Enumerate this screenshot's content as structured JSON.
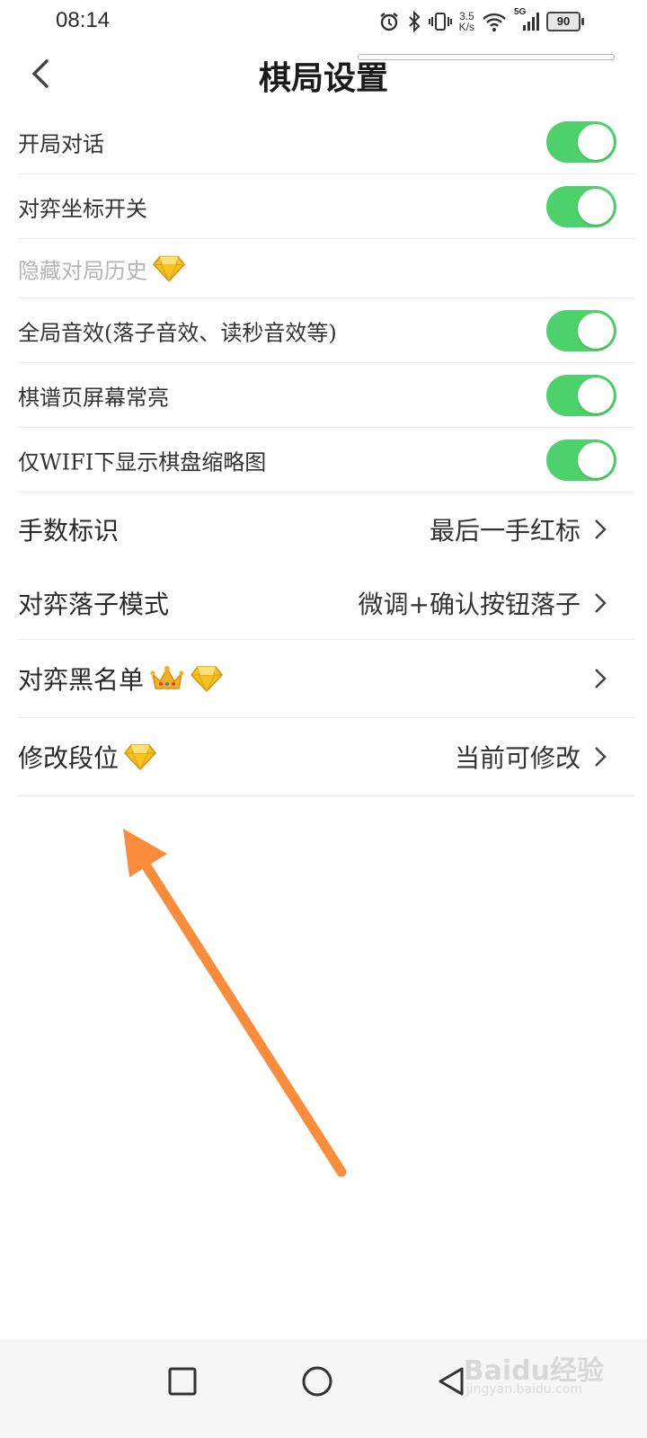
{
  "status_bar": {
    "time": "08:14",
    "net_speed_value": "3.5",
    "net_speed_unit": "K/s",
    "network": "5G",
    "battery": "90",
    "icons": [
      "alarm-icon",
      "bluetooth-icon",
      "vibrate-icon",
      "wifi-icon",
      "signal-icon",
      "battery-icon"
    ]
  },
  "header": {
    "title": "棋局设置",
    "back_icon": "back-arrow-icon"
  },
  "settings": {
    "opening_dialog": {
      "label": "开局对话",
      "enabled": true
    },
    "coordinates": {
      "label": "对弈坐标开关",
      "enabled": true
    },
    "hide_history": {
      "label": "隐藏对局历史",
      "disabled": true,
      "badge": "diamond-icon"
    },
    "global_sound": {
      "label": "全局音效(落子音效、读秒音效等)",
      "enabled": true
    },
    "screen_on": {
      "label": "棋谱页屏幕常亮",
      "enabled": true
    },
    "wifi_thumbnail": {
      "label": "仅WIFI下显示棋盘缩略图",
      "enabled": true
    },
    "move_marker": {
      "label": "手数标识",
      "value": "最后一手红标"
    },
    "place_mode": {
      "label": "对弈落子模式",
      "value": "微调+确认按钮落子"
    },
    "blacklist": {
      "label": "对弈黑名单",
      "disabled": true,
      "badges": [
        "crown-icon",
        "diamond-icon"
      ]
    },
    "modify_rank": {
      "label": "修改段位",
      "value": "当前可修改",
      "badge": "diamond-icon"
    }
  },
  "colors": {
    "toggle_on": "#4cd16b",
    "annotation_arrow": "#fb8c3b",
    "disabled_text": "#b5b5b5"
  },
  "nav_bar": {
    "buttons": [
      "recent-apps-button",
      "home-button",
      "back-button"
    ],
    "watermark": "Baidu经验",
    "watermark_sub": "jingyan.baidu.com"
  }
}
